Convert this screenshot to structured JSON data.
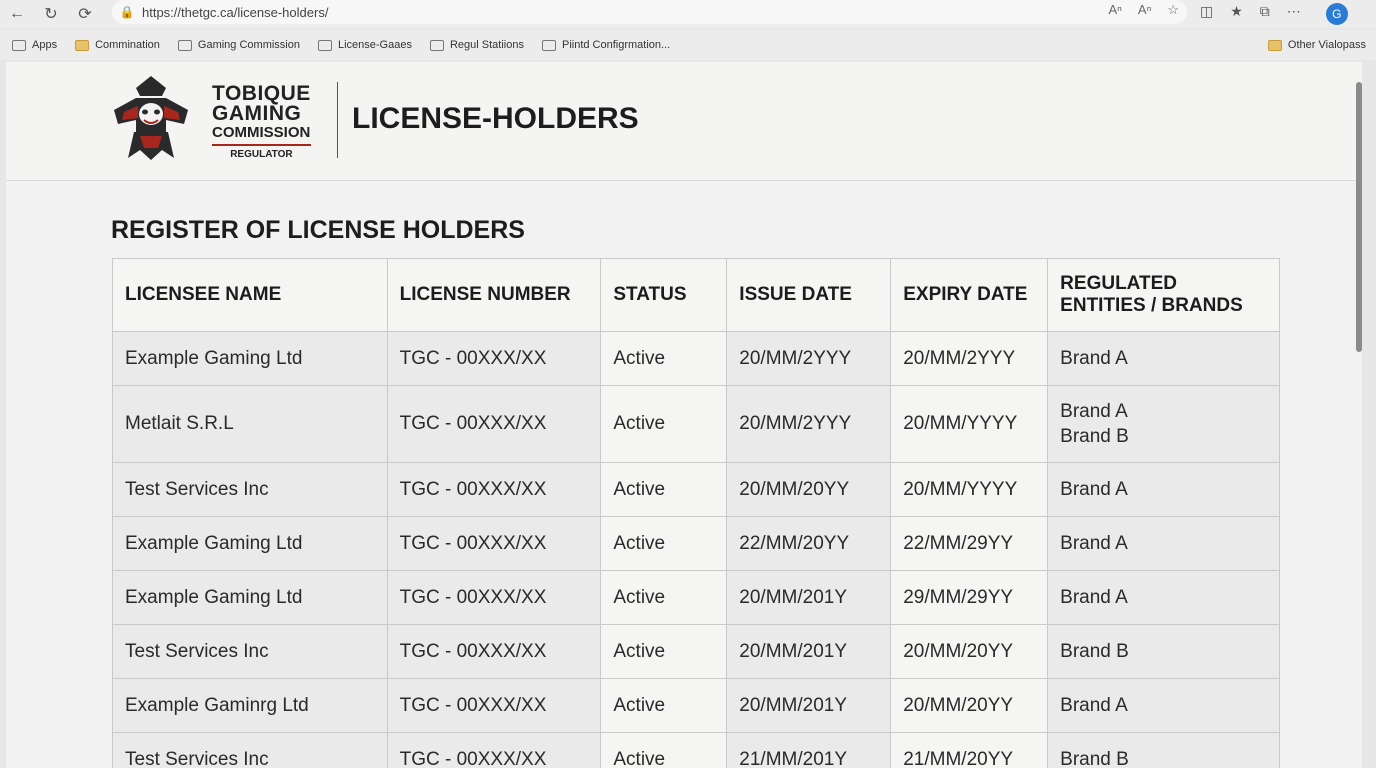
{
  "browser": {
    "url": "https://thetgc.ca/license-holders/",
    "bookmarks": [
      "Apps",
      "Commination",
      "Gaming Commission",
      "License-Gaaes",
      "Regul Statiions",
      "Piintd Configrmation..."
    ],
    "other_bookmarks": "Other Vialopass"
  },
  "header": {
    "logo_lines": [
      "TOBIQUE",
      "GAMING",
      "COMMISSION",
      "REGULATOR"
    ],
    "title": "LICENSE-HOLDERS"
  },
  "section": {
    "title": "REGISTER OF LICENSE HOLDERS"
  },
  "table": {
    "columns": [
      "LICENSEE NAME",
      "LICENSE NUMBER",
      "STATUS",
      "ISSUE DATE",
      "EXPIRY DATE",
      "REGULATED ENTITIES / BRANDS"
    ],
    "rows": [
      {
        "name": "Example Gaming Ltd",
        "number": "TGC - 00XXX/XX",
        "status": "Active",
        "issue": "20/MM/2YYY",
        "expiry": "20/MM/2YYY",
        "brands": [
          "Brand A"
        ]
      },
      {
        "name": "Metlait S.R.L",
        "number": "TGC - 00XXX/XX",
        "status": "Active",
        "issue": "20/MM/2YYY",
        "expiry": "20/MM/YYYY",
        "brands": [
          "Brand A",
          "Brand B"
        ]
      },
      {
        "name": "Test Services Inc",
        "number": "TGC - 00XXX/XX",
        "status": "Active",
        "issue": "20/MM/20YY",
        "expiry": "20/MM/YYYY",
        "brands": [
          "Brand A"
        ]
      },
      {
        "name": "Example Gaming Ltd",
        "number": "TGC - 00XXX/XX",
        "status": "Active",
        "issue": "22/MM/20YY",
        "expiry": "22/MM/29YY",
        "brands": [
          "Brand A"
        ]
      },
      {
        "name": "Example Gaming Ltd",
        "number": "TGC - 00XXX/XX",
        "status": "Active",
        "issue": "20/MM/201Y",
        "expiry": "29/MM/29YY",
        "brands": [
          "Brand A"
        ]
      },
      {
        "name": "Test Services Inc",
        "number": "TGC - 00XXX/XX",
        "status": "Active",
        "issue": "20/MM/201Y",
        "expiry": "20/MM/20YY",
        "brands": [
          "Brand B"
        ]
      },
      {
        "name": "Example Gaminrg Ltd",
        "number": "TGC - 00XXX/XX",
        "status": "Active",
        "issue": "20/MM/201Y",
        "expiry": "20/MM/20YY",
        "brands": [
          "Brand A"
        ]
      },
      {
        "name": "Test Services Inc",
        "number": "TGC - 00XXX/XX",
        "status": "Active",
        "issue": "21/MM/201Y",
        "expiry": "21/MM/20YY",
        "brands": [
          "Brand B"
        ]
      }
    ]
  }
}
